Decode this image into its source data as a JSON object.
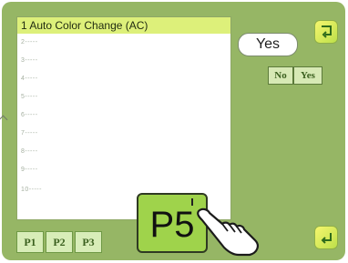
{
  "list": {
    "header": "1 Auto Color Change (AC)",
    "items": [
      "2-----",
      "3-----",
      "4-----",
      "5-----",
      "6-----",
      "7-----",
      "8-----",
      "9-----",
      "10-----"
    ]
  },
  "buttons": {
    "yes_main": "Yes",
    "no": "No",
    "yes_small": "Yes"
  },
  "tabs": [
    "P1",
    "P2",
    "P3"
  ],
  "key": {
    "label": "P5"
  },
  "colors": {
    "panel_bg": "#96b665",
    "header_bg": "#ddf07a",
    "key_bg": "#9fd34b"
  }
}
